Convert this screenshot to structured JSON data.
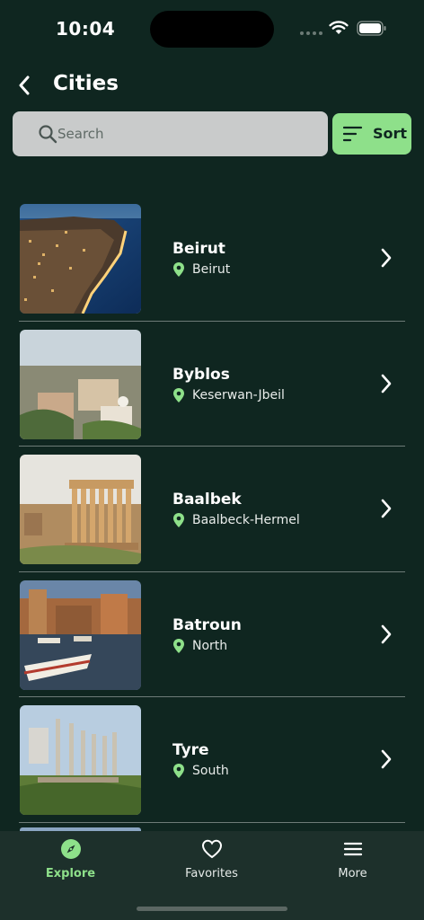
{
  "status": {
    "time": "10:04"
  },
  "header": {
    "title": "Cities"
  },
  "search": {
    "placeholder": "Search",
    "value": ""
  },
  "sort": {
    "label": "Sort"
  },
  "cities": [
    {
      "name": "Beirut",
      "region": "Beirut"
    },
    {
      "name": "Byblos",
      "region": "Keserwan-Jbeil"
    },
    {
      "name": "Baalbek",
      "region": "Baalbeck-Hermel"
    },
    {
      "name": "Batroun",
      "region": "North"
    },
    {
      "name": "Tyre",
      "region": "South"
    }
  ],
  "tabs": [
    {
      "label": "Explore",
      "icon": "compass-icon",
      "active": true
    },
    {
      "label": "Favorites",
      "icon": "heart-icon",
      "active": false
    },
    {
      "label": "More",
      "icon": "menu-icon",
      "active": false
    }
  ],
  "colors": {
    "background": "#0f2620",
    "accent": "#8ee08a",
    "search_bg": "#c9cbcb",
    "tab_bar": "#1d302b"
  }
}
